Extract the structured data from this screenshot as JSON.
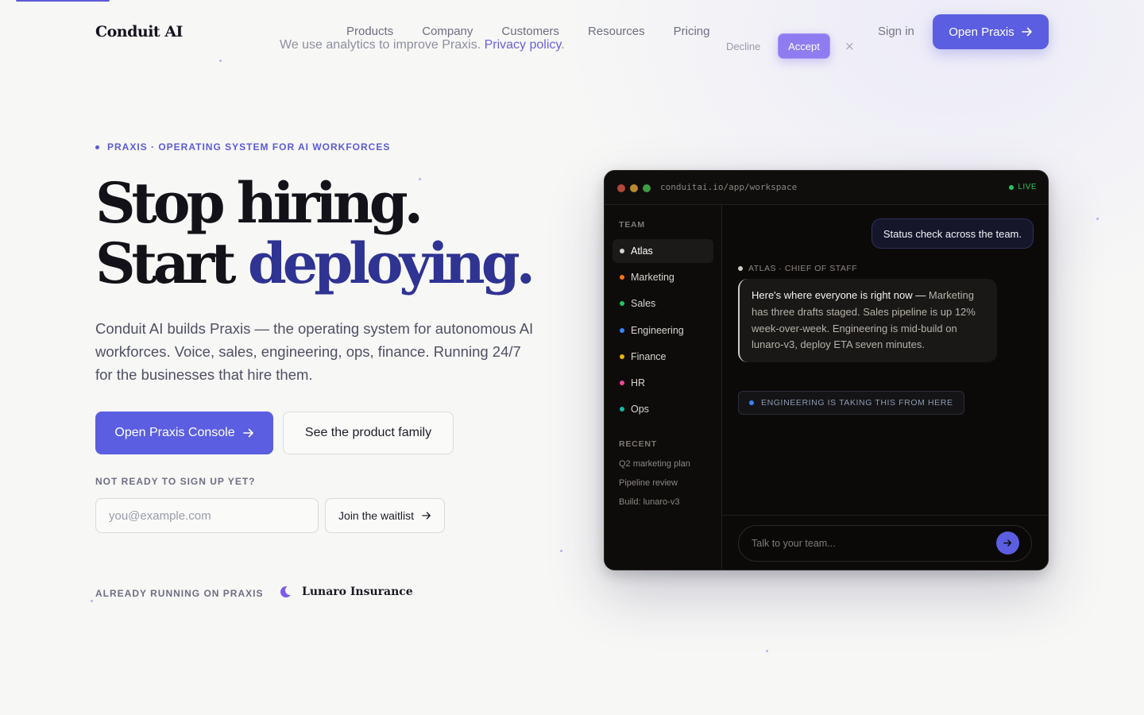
{
  "header": {
    "logo": "Conduit AI",
    "nav": [
      "Products",
      "Company",
      "Customers",
      "Resources",
      "Pricing"
    ],
    "sign_in": "Sign in",
    "cta": "Open Praxis"
  },
  "cookie": {
    "text": "We use analytics to improve Praxis. ",
    "link": "Privacy policy",
    "link_suffix": ".",
    "decline": "Decline",
    "accept": "Accept",
    "close": "×"
  },
  "hero": {
    "eyebrow": "PRAXIS · OPERATING SYSTEM FOR AI WORKFORCES",
    "headline_1": "Stop hiring.",
    "headline_2a": "Start ",
    "headline_2b": "deploying.",
    "subtitle": "Conduit AI builds Praxis — the operating system for autonomous AI workforces. Voice, sales, engineering, ops, finance. Running 24/7 for the businesses that hire them.",
    "primary_cta": "Open Praxis Console",
    "secondary_cta": "See the product family",
    "not_ready": "NOT READY TO SIGN UP YET?",
    "email_placeholder": "you@example.com",
    "waitlist": "Join the waitlist",
    "already": "ALREADY RUNNING ON PRAXIS",
    "customer": "Lunaro Insurance"
  },
  "app": {
    "url": "conduitai.io/app/workspace",
    "live": "LIVE",
    "team_heading": "TEAM",
    "team": [
      {
        "name": "Atlas",
        "color": "#d6d3d1",
        "active": true
      },
      {
        "name": "Marketing",
        "color": "#f97316"
      },
      {
        "name": "Sales",
        "color": "#22c55e"
      },
      {
        "name": "Engineering",
        "color": "#3b82f6"
      },
      {
        "name": "Finance",
        "color": "#eab308"
      },
      {
        "name": "HR",
        "color": "#ec4899"
      },
      {
        "name": "Ops",
        "color": "#14b8a6"
      }
    ],
    "recent_heading": "RECENT",
    "recent": [
      "Q2 marketing plan",
      "Pipeline review",
      "Build: lunaro-v3"
    ],
    "user_message": "Status check across the team.",
    "agent_label": "ATLAS · CHIEF OF STAFF",
    "agent_lead": "Here's where everyone is right now —",
    "agent_body": " Marketing has three drafts staged. Sales pipeline is up 12% week-over-week. Engineering is mid-build on lunaro-v3, deploy ETA seven minutes.",
    "handoff": "ENGINEERING IS TAKING THIS FROM HERE",
    "composer_placeholder": "Talk to your team..."
  },
  "colors": {
    "accent": "#5b5ee0",
    "window_bg": "#0c0a09"
  }
}
